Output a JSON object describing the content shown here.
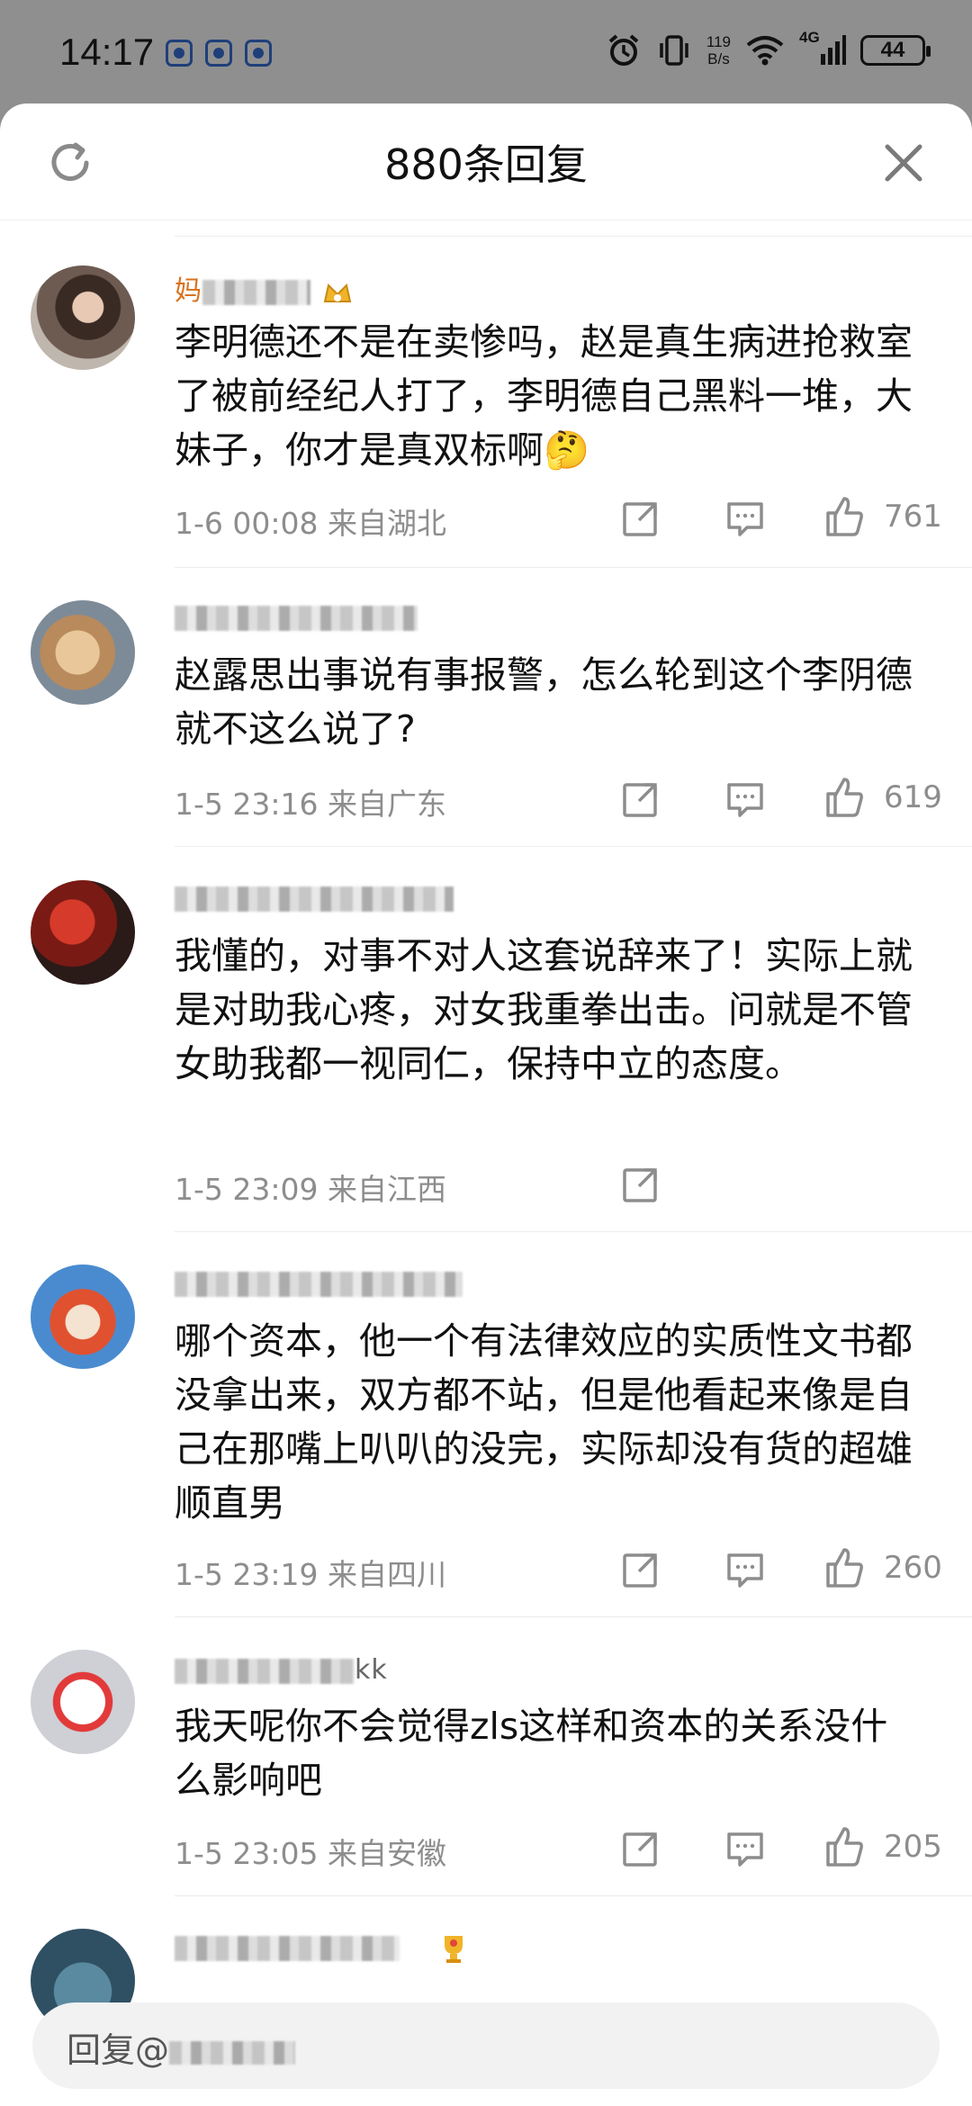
{
  "status_bar": {
    "time": "14:17",
    "speed_value": "119",
    "speed_unit": "B/s",
    "network": "4G",
    "battery": "44"
  },
  "header": {
    "title": "880条回复"
  },
  "comments": [
    {
      "username": "妈",
      "text": "李明德还不是在卖惨吗，赵是真生病进抢救室了被前经纪人打了，李明德自己黑料一堆，大妹子，你才是真双标啊🤔",
      "time": "1-6 00:08",
      "location": "来自湖北",
      "likes": "761"
    },
    {
      "username": "",
      "text": "赵露思出事说有事报警，怎么轮到这个李阴德就不这么说了?",
      "time": "1-5 23:16",
      "location": "来自广东",
      "likes": "619"
    },
    {
      "username": "",
      "text": "我懂的，对事不对人这套说辞来了！实际上就是对助我心疼，对女我重拳出击。问就是不管女助我都一视同仁，保持中立的态度。",
      "time": "1-5 23:09",
      "location": "来自江西",
      "likes": ""
    },
    {
      "username": "",
      "text": "哪个资本，他一个有法律效应的实质性文书都没拿出来，双方都不站，但是他看起来像是自己在那嘴上叭叭的没完，实际却没有货的超雄顺直男",
      "time": "1-5 23:19",
      "location": "来自四川",
      "likes": "260"
    },
    {
      "username": "kk",
      "text": "我天呢你不会觉得zls这样和资本的关系没什么影响吧",
      "time": "1-5 23:05",
      "location": "来自安徽",
      "likes": "205"
    },
    {
      "username": "",
      "text": "",
      "time": "",
      "location": "",
      "likes": ""
    }
  ],
  "reply_bar": {
    "label": "回复@"
  },
  "colors": {
    "username": "#d9721d",
    "meta": "#8d8d8d",
    "icon": "#8d8d8d"
  },
  "icons": [
    "refresh-icon",
    "close-icon",
    "share-icon",
    "comment-icon",
    "like-icon"
  ]
}
